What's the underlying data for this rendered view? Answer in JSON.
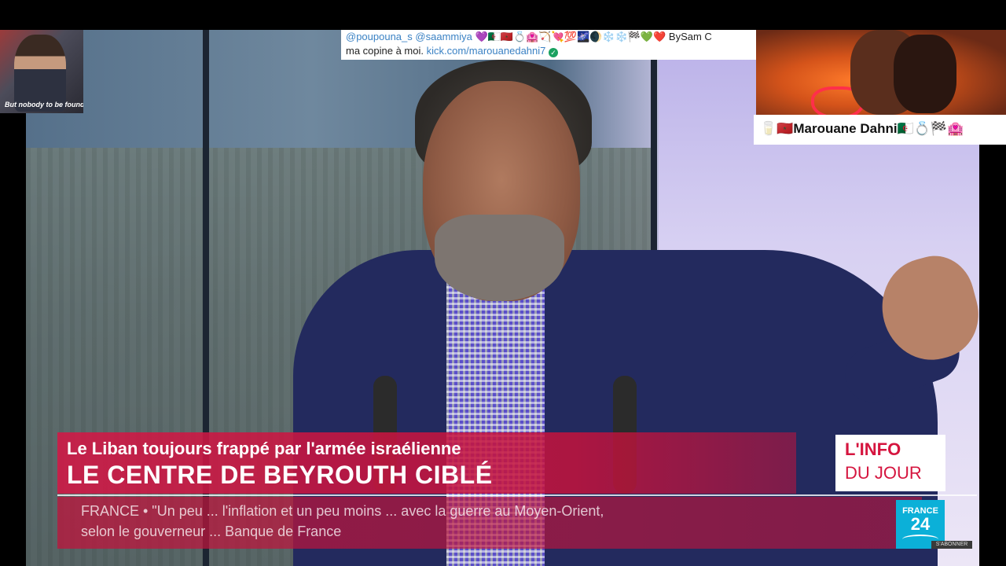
{
  "chat": {
    "handle1": "@poupouna_s",
    "handle2": "@saammiya",
    "emojis": "💜🇩🇿🇲🇦💍🏩🏹💘💯🌌🌒❄️❄️🏁💚❤️",
    "signature": "BySam C",
    "line2_text": "ma copine à moi.",
    "link": "kick.com/marouanedahni7",
    "verified": "✓"
  },
  "thumb_left": {
    "caption": "But nobody to be found"
  },
  "name_bar": {
    "text": "🥛🇲🇦Marouane Dahni🇩🇿💍🏁🏩"
  },
  "lower_third": {
    "subtitle": "Le Liban toujours frappé par l'armée israélienne",
    "headline": "LE CENTRE DE BEYROUTH CIBLÉ",
    "ticker_line1": "FRANCE • \"Un peu ... l'inflation et un peu moins ... avec la guerre au Moyen-Orient,",
    "ticker_line2": "selon le gouverneur ... Banque de France",
    "program_line1": "L'INFO",
    "program_line2": "DU JOUR"
  },
  "channel": {
    "name_line1": "FRANCE",
    "name_line2": "24",
    "subscribe": "S'ABONNER"
  },
  "colors": {
    "accent_red": "#d5153f",
    "channel_blue": "#0bb0d8"
  }
}
